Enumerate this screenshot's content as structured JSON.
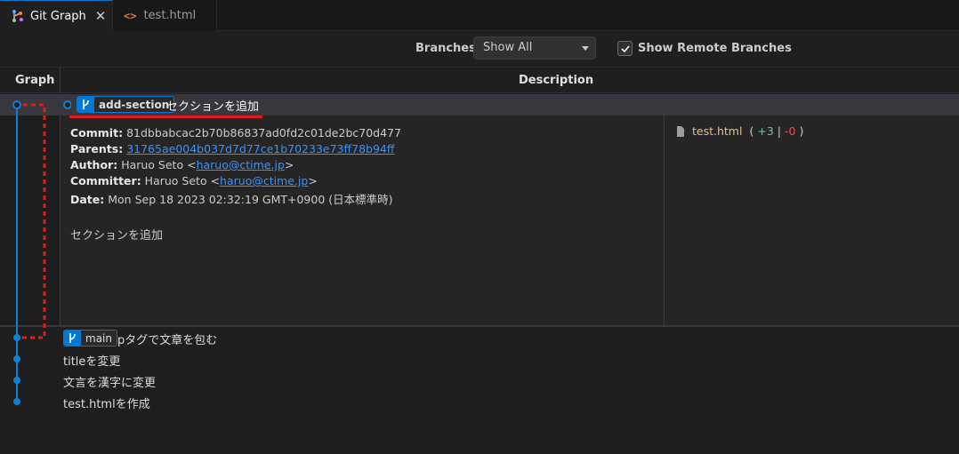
{
  "tabs": [
    {
      "label": "Git Graph",
      "active": true,
      "icon": "git-graph-icon"
    },
    {
      "label": "test.html",
      "active": false,
      "icon": "code-file-icon"
    }
  ],
  "controls": {
    "branches_label": "Branches:",
    "branches_value": "Show All",
    "show_remote_label": "Show Remote Branches",
    "show_remote_checked": true
  },
  "table": {
    "col_graph": "Graph",
    "col_description": "Description"
  },
  "selected_commit": {
    "branch": "add-section",
    "message": "セクションを追加",
    "commit_label": "Commit:",
    "commit_hash": "81dbbabcac2b70b86837ad0fd2c01de2bc70d477",
    "parents_label": "Parents:",
    "parents_hash": "31765ae004b037d7d77ce1b70233e73ff78b94ff",
    "author_label": "Author:",
    "author_name": "Haruo Seto",
    "author_email": "haruo@ctime.jp",
    "committer_label": "Committer:",
    "committer_name": "Haruo Seto",
    "committer_email": "haruo@ctime.jp",
    "date_label": "Date:",
    "date_value": "Mon Sep 18 2023 02:32:19 GMT+0900 (日本標準時)",
    "body": "セクションを追加",
    "files": [
      {
        "name": "test.html",
        "additions": "+3",
        "deletions": "-0"
      }
    ]
  },
  "commits": [
    {
      "branch": "main",
      "message": "pタグで文章を包む"
    },
    {
      "branch": "",
      "message": "titleを変更"
    },
    {
      "branch": "",
      "message": "文言を漢字に変更"
    },
    {
      "branch": "",
      "message": "test.htmlを作成"
    }
  ],
  "colors": {
    "graph_line": "#0e7fd6",
    "accent": "#0078d4",
    "annotation": "#e01b1b"
  }
}
